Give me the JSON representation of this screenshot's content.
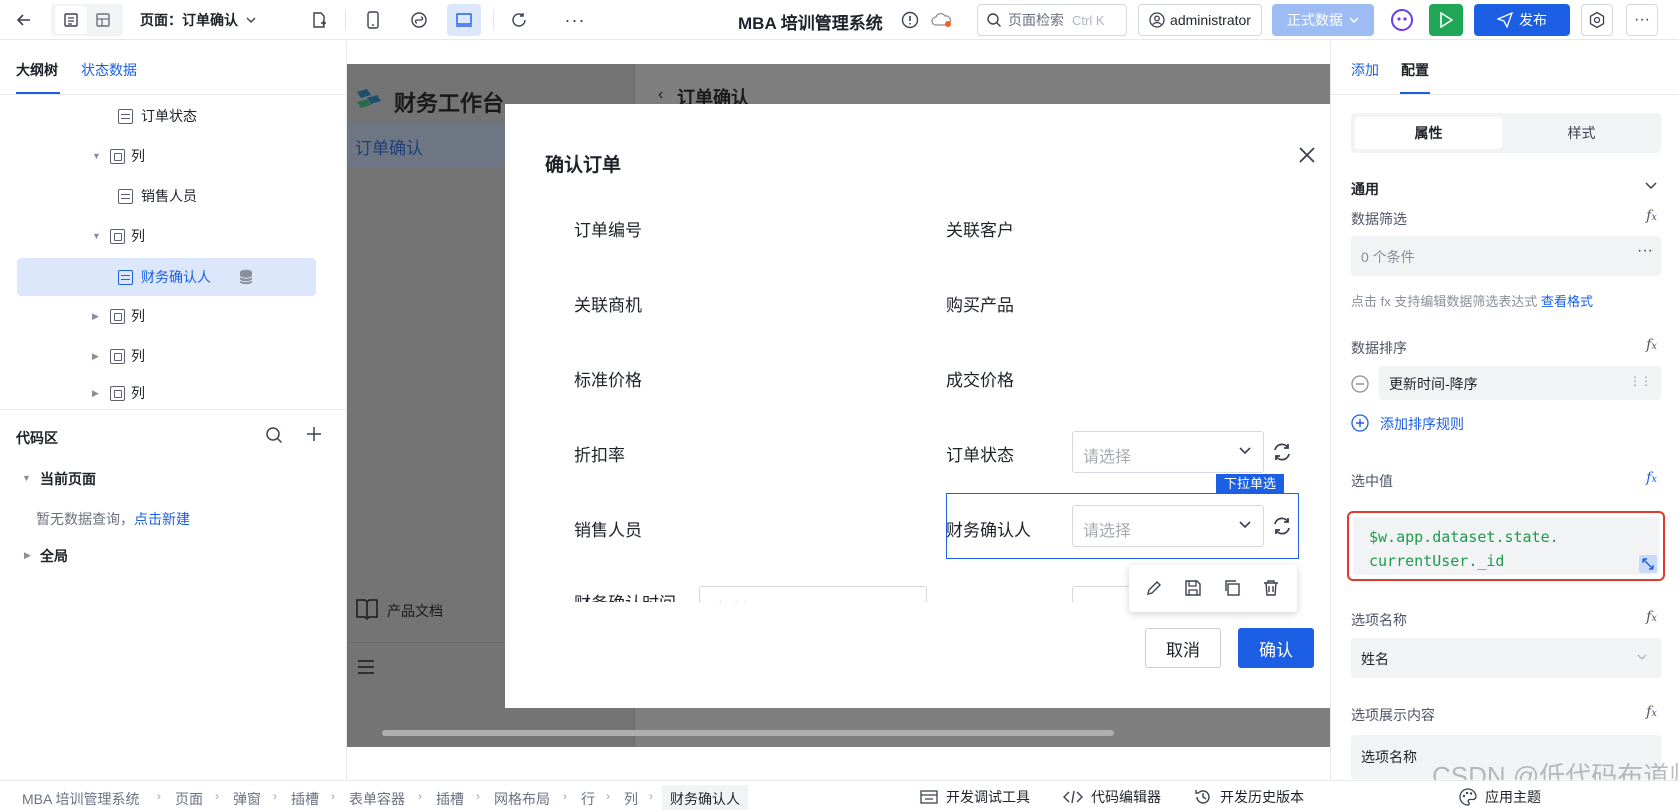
{
  "topbar": {
    "page_label": "页面：订单确认",
    "app_title": "MBA 培训管理系统",
    "search_placeholder": "页面检索",
    "search_shortcut": "Ctrl K",
    "user": "administrator",
    "env_label": "正式数据",
    "publish_label": "发布"
  },
  "left": {
    "tabs": [
      "大纲树",
      "状态数据"
    ],
    "tree": [
      {
        "label": "订单状态",
        "icon": "form-item-icon"
      },
      {
        "label": "列",
        "icon": "column-icon"
      },
      {
        "label": "销售人员",
        "icon": "form-item-icon"
      },
      {
        "label": "列",
        "icon": "column-icon"
      },
      {
        "label": "财务确认人",
        "icon": "form-item-icon"
      },
      {
        "label": "列",
        "icon": "column-icon"
      },
      {
        "label": "列",
        "icon": "column-icon"
      },
      {
        "label": "列",
        "icon": "column-icon"
      }
    ],
    "code_title": "代码区",
    "current_page": "当前页面",
    "empty_query": "暂无数据查询，",
    "new_link": "点击新建",
    "global": "全局"
  },
  "canvas": {
    "brand": "财务工作台",
    "nav_item": "订单确认",
    "page_header": "订单确认",
    "doc_link": "产品文档",
    "modal": {
      "title": "确认订单",
      "fields": {
        "order_no": "订单编号",
        "customer": "关联客户",
        "opportunity": "关联商机",
        "product": "购买产品",
        "std_price": "标准价格",
        "deal_price": "成交价格",
        "discount": "折扣率",
        "order_status": "订单状态",
        "sales": "销售人员",
        "finance": "财务确认人",
        "finance_time": "财务确认时间"
      },
      "select_placeholder": "请选择",
      "selected_badge": "下拉单选",
      "cancel": "取消",
      "confirm": "确认"
    }
  },
  "right": {
    "tabs": [
      "添加",
      "配置"
    ],
    "seg": [
      "属性",
      "样式"
    ],
    "general": "通用",
    "data_filter": "数据筛选",
    "filter_value": "0 个条件",
    "filter_hint": "点击 fx 支持编辑数据筛选表达式",
    "filter_hint_link": "查看格式",
    "data_sort": "数据排序",
    "sort_rule": "更新时间-降序",
    "add_sort": "添加排序规则",
    "selected_value": "选中值",
    "selected_expr": "$w.app.dataset.state.\ncurrentUser._id",
    "option_name": "选项名称",
    "option_name_value": "姓名",
    "option_display": "选项展示内容",
    "option_display_value": "选项名称"
  },
  "footer": {
    "crumbs": [
      "MBA 培训管理系统",
      "页面",
      "弹窗",
      "插槽",
      "表单容器",
      "插槽",
      "网格布局",
      "行",
      "列",
      "财务确认人"
    ],
    "debug": "开发调试工具",
    "code_editor": "代码编辑器",
    "history": "开发历史版本",
    "theme": "应用主题"
  },
  "watermark": "CSDN @低代码布道师"
}
